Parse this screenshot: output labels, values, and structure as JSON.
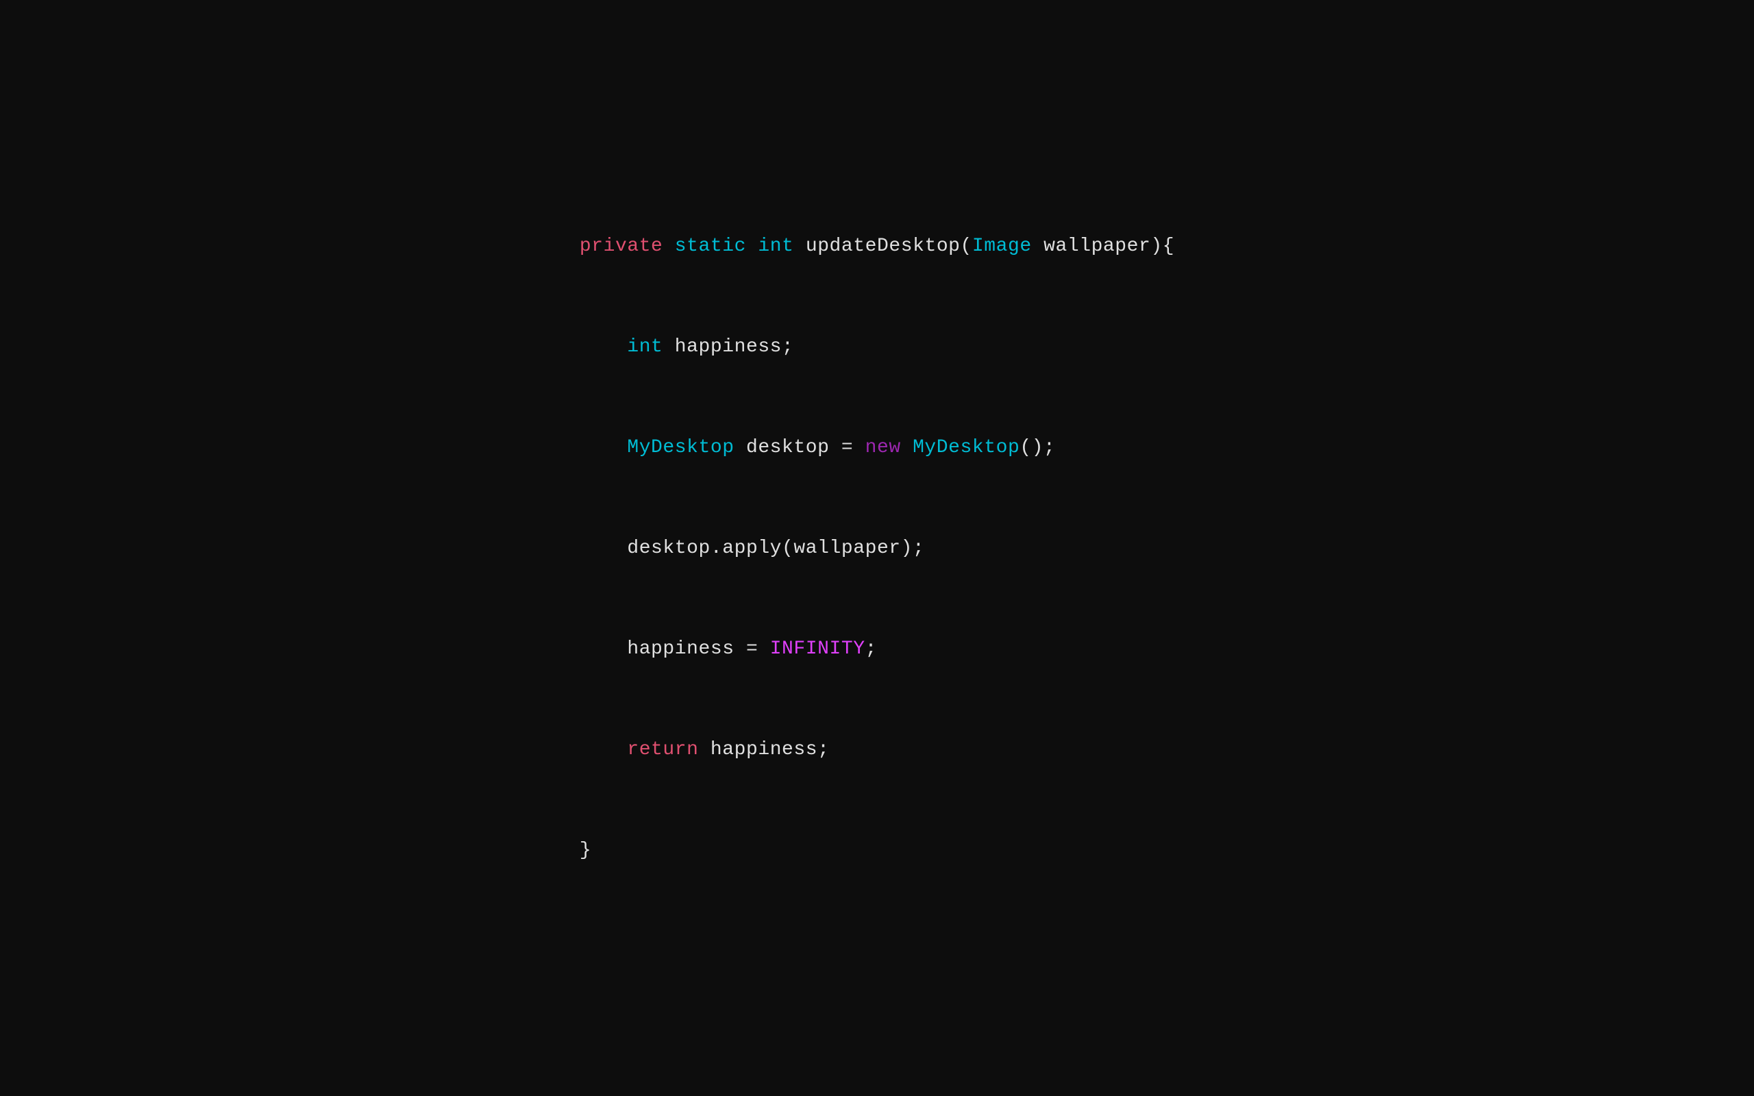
{
  "background": "#0d0d0d",
  "code": {
    "line1": {
      "keyword_private": "private",
      "space1": " ",
      "keyword_static": "static",
      "space2": " ",
      "keyword_int": "int",
      "space3": " ",
      "method": "updateDesktop(",
      "type_image": "Image",
      "param": " wallpaper){"
    },
    "line2": {
      "indent": "    ",
      "keyword_int": "int",
      "rest": " happiness;"
    },
    "line3": {
      "indent": "    ",
      "class_mydesktop": "MyDesktop",
      "rest": " desktop = ",
      "keyword_new": "new",
      "space": " ",
      "class_mydesktop2": "MyDesktop",
      "end": "();"
    },
    "line4": {
      "indent": "    ",
      "plain": "desktop.apply(wallpaper);"
    },
    "line5": {
      "indent": "    ",
      "plain_start": "happiness = ",
      "constant": "INFINITY",
      "end": ";"
    },
    "line6": {
      "indent": "    ",
      "keyword_return": "return",
      "rest": " happiness;"
    },
    "line7": {
      "brace": "}"
    }
  }
}
